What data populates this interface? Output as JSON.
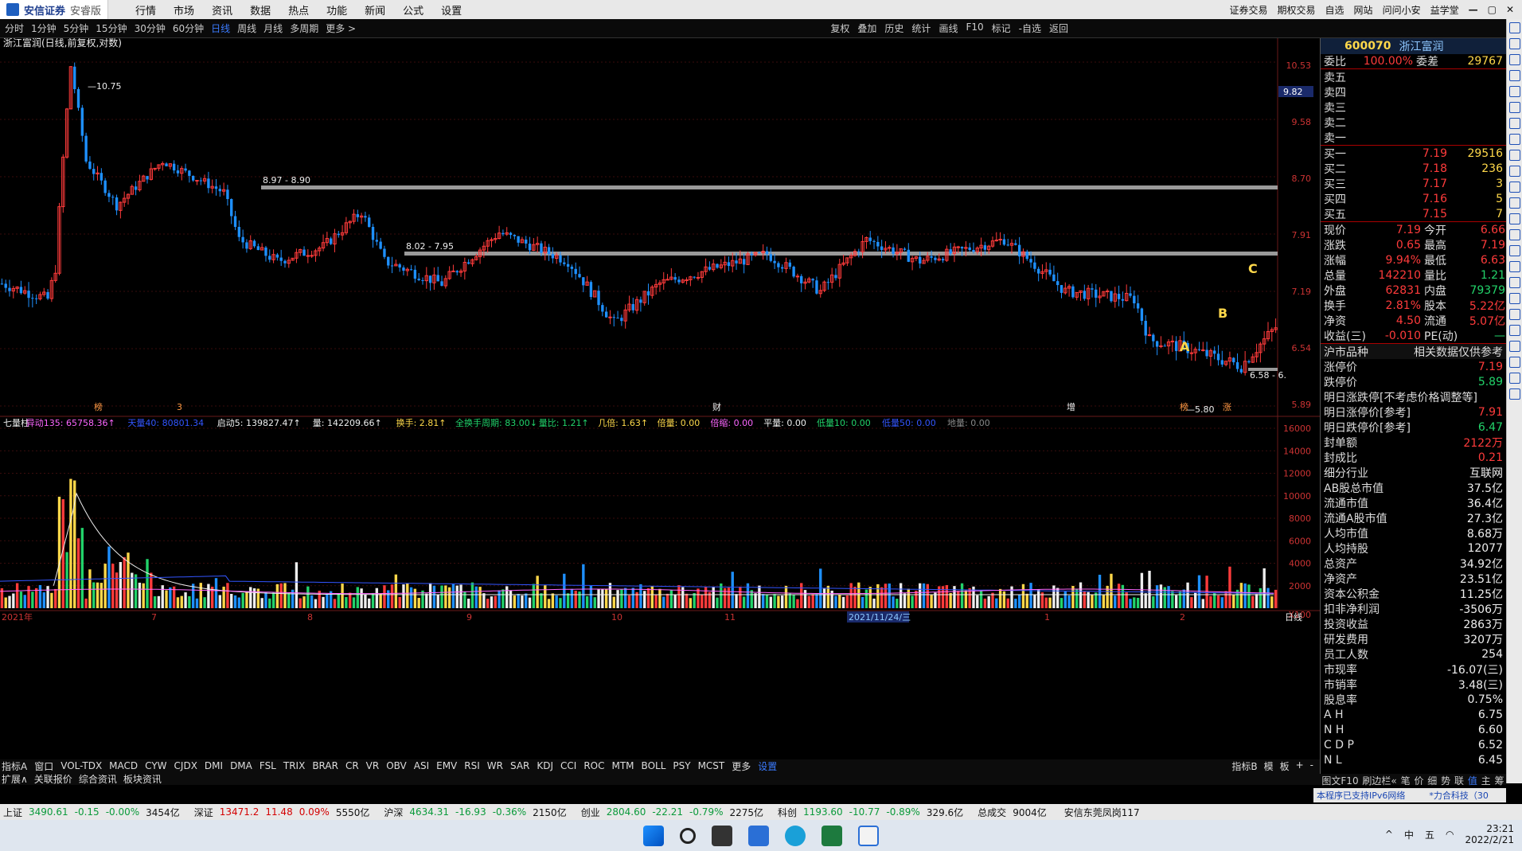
{
  "app": {
    "brand": "安信证券",
    "edition": "安睿版",
    "menu": [
      "行情",
      "市场",
      "资讯",
      "数据",
      "热点",
      "功能",
      "新闻",
      "公式",
      "设置"
    ],
    "right_menu": [
      "证券交易",
      "期权交易",
      "自选",
      "网站",
      "问问小安",
      "益学堂"
    ],
    "window_controls": [
      "—",
      "▢",
      "✕"
    ]
  },
  "periodbar": {
    "periods": [
      "分时",
      "1分钟",
      "5分钟",
      "15分钟",
      "30分钟",
      "60分钟",
      "日线",
      "周线",
      "月线",
      "多周期",
      "更多 >"
    ],
    "active": "日线",
    "tools": [
      "复权",
      "叠加",
      "历史",
      "统计",
      "画线",
      "F10",
      "标记",
      "-自选",
      "返回"
    ]
  },
  "chart": {
    "title": "浙江富润(日线,前复权,对数)",
    "high_label": "10.75",
    "low_label": "5.80",
    "zone1": "8.97 - 8.90",
    "zone2": "8.02 - 7.95",
    "zone3": "6.58 - 6.",
    "cursor_price": "9.82",
    "price_axis": [
      "10.53",
      "9.58",
      "8.70",
      "7.91",
      "7.19",
      "6.54",
      "5.89"
    ],
    "markers": [
      "A",
      "B",
      "C"
    ],
    "event_labels": [
      "榜",
      "3",
      "财",
      "增",
      "榜",
      "涨"
    ],
    "volume_axis": [
      "16000",
      "14000",
      "12000",
      "10000",
      "8000",
      "6000",
      "4000",
      "2000",
      "X100"
    ],
    "date_axis": [
      "2021年",
      "7",
      "8",
      "9",
      "10",
      "11",
      "2021/11/24/三",
      "1",
      "2"
    ],
    "date_axis_right": "日线",
    "indicator_header": [
      {
        "label": "七量柱",
        "color": "#eeeeee"
      },
      {
        "label": "异动135: 65758.36↑",
        "color": "#ff66ff"
      },
      {
        "label": "天量40: 80801.34",
        "color": "#3355ff"
      },
      {
        "label": "启动5: 139827.47↑",
        "color": "#eeeeee"
      },
      {
        "label": "量: 142209.66↑",
        "color": "#eeeeee"
      },
      {
        "label": "换手: 2.81↑",
        "color": "#ffd84a"
      },
      {
        "label": "全换手周期: 83.00↓",
        "color": "#22d36a"
      },
      {
        "label": "量比: 1.21↑",
        "color": "#22d36a"
      },
      {
        "label": "几倍: 1.63↑",
        "color": "#ffd84a"
      },
      {
        "label": "倍量: 0.00",
        "color": "#ffd84a"
      },
      {
        "label": "倍缩: 0.00",
        "color": "#ff66ff"
      },
      {
        "label": "平量: 0.00",
        "color": "#eeeeee"
      },
      {
        "label": "低量10: 0.00",
        "color": "#22d36a"
      },
      {
        "label": "低量50: 0.00",
        "color": "#3355ff"
      },
      {
        "label": "地量: 0.00",
        "color": "#888888"
      }
    ]
  },
  "indicators": [
    "指标A",
    "窗口",
    "VOL-TDX",
    "MACD",
    "CYW",
    "CJDX",
    "DMI",
    "DMA",
    "FSL",
    "TRIX",
    "BRAR",
    "CR",
    "VR",
    "OBV",
    "ASI",
    "EMV",
    "RSI",
    "WR",
    "SAR",
    "KDJ",
    "CCI",
    "ROC",
    "MTM",
    "BOLL",
    "PSY",
    "MCST",
    "更多",
    "设置"
  ],
  "indicators_right": [
    "指标B",
    "模",
    "板",
    "+",
    "-"
  ],
  "tabs": [
    "扩展∧",
    "关联报价",
    "综合资讯",
    "板块资讯"
  ],
  "tabs_right": [
    "图文F10",
    "刷边栏«",
    "笔",
    "价",
    "细",
    "势",
    "联",
    "值",
    "主",
    "筹"
  ],
  "quote": {
    "code": "600070",
    "name": "浙江富润",
    "weibi": {
      "label": "委比",
      "pct": "100.00%",
      "label2": "委差",
      "val": "29767"
    },
    "sells": [
      "卖五",
      "卖四",
      "卖三",
      "卖二",
      "卖一"
    ],
    "buys": [
      {
        "label": "买一",
        "price": "7.19",
        "vol": "29516"
      },
      {
        "label": "买二",
        "price": "7.18",
        "vol": "236"
      },
      {
        "label": "买三",
        "price": "7.17",
        "vol": "3"
      },
      {
        "label": "买四",
        "price": "7.16",
        "vol": "5"
      },
      {
        "label": "买五",
        "price": "7.15",
        "vol": "7"
      }
    ],
    "stats": [
      [
        "现价",
        "7.19",
        "今开",
        "6.66"
      ],
      [
        "涨跌",
        "0.65",
        "最高",
        "7.19"
      ],
      [
        "涨幅",
        "9.94%",
        "最低",
        "6.63"
      ],
      [
        "总量",
        "142210",
        "量比",
        "1.21"
      ],
      [
        "外盘",
        "62831",
        "内盘",
        "79379"
      ],
      [
        "换手",
        "2.81%",
        "股本",
        "5.22亿"
      ],
      [
        "净资",
        "4.50",
        "流通",
        "5.07亿"
      ],
      [
        "收益(三)",
        "-0.010",
        "PE(动)",
        "—"
      ]
    ],
    "section": {
      "label": "沪市品种",
      "note": "相关数据仅供参考"
    },
    "limits": [
      [
        "涨停价",
        "7.19"
      ],
      [
        "跌停价",
        "5.89"
      ],
      [
        "明日涨跌停[不考虑价格调整等]",
        ""
      ],
      [
        "明日涨停价[参考]",
        "7.91"
      ],
      [
        "明日跌停价[参考]",
        "6.47"
      ],
      [
        "封单额",
        "2122万"
      ],
      [
        "封成比",
        "0.21"
      ],
      [
        "细分行业",
        "互联网"
      ],
      [
        "AB股总市值",
        "37.5亿"
      ],
      [
        "流通市值",
        "36.4亿"
      ],
      [
        "流通A股市值",
        "27.3亿"
      ],
      [
        "人均市值",
        "8.68万"
      ],
      [
        "人均持股",
        "12077"
      ],
      [
        "总资产",
        "34.92亿"
      ],
      [
        "净资产",
        "23.51亿"
      ],
      [
        "资本公积金",
        "11.25亿"
      ],
      [
        "扣非净利润",
        "-3506万"
      ],
      [
        "投资收益",
        "2863万"
      ],
      [
        "研发费用",
        "3207万"
      ],
      [
        "员工人数",
        "254"
      ],
      [
        "市现率",
        "-16.07(三)"
      ],
      [
        "市销率",
        "3.48(三)"
      ],
      [
        "股息率",
        "0.75%"
      ],
      [
        "A H",
        "6.75"
      ],
      [
        "N H",
        "6.60"
      ],
      [
        "C D P",
        "6.52"
      ],
      [
        "N L",
        "6.45"
      ]
    ]
  },
  "statusbar": [
    {
      "name": "上证",
      "val": "3490.61",
      "chg": "-0.15",
      "pct": "-0.00%",
      "amt": "3454亿"
    },
    {
      "name": "深证",
      "val": "13471.2",
      "chg": "11.48",
      "pct": "0.09%",
      "amt": "5550亿"
    },
    {
      "name": "沪深",
      "val": "4634.31",
      "chg": "-16.93",
      "pct": "-0.36%",
      "amt": "2150亿"
    },
    {
      "name": "创业",
      "val": "2804.60",
      "chg": "-22.21",
      "pct": "-0.79%",
      "amt": "2275亿"
    },
    {
      "name": "科创",
      "val": "1193.60",
      "chg": "-10.77",
      "pct": "-0.89%",
      "amt": "329.6亿"
    }
  ],
  "status_total": {
    "label": "总成交",
    "val": "9004亿"
  },
  "status_server": "安信东莞凤岗117",
  "notice": {
    "text": "本程序已支持IPv6网络",
    "vendor": "*力合科技（30"
  },
  "taskbar": {
    "time": "23:21",
    "date": "2022/2/21",
    "ime": "中",
    "ime2": "五"
  },
  "colors": {
    "up": "#ff3b3b",
    "down": "#1e90ff",
    "ma": "#eeeeee",
    "zone": "#a0a0a0"
  }
}
